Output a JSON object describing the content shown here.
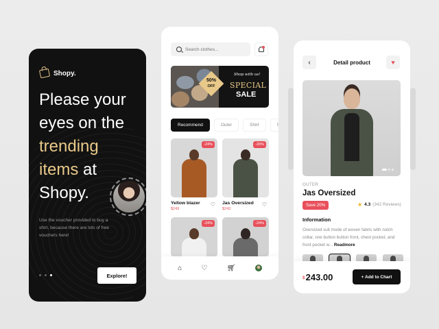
{
  "onboarding": {
    "brand": "Shopy.",
    "headline_1": "Please your eyes on the",
    "headline_gold": "trending items",
    "headline_2": " at Shopy.",
    "voucher_text": "Use the voucher provided to buy a shirt, because there are lots of free vouchers here!",
    "explore_label": "Explore!"
  },
  "home": {
    "search_placeholder": "Search clothes...",
    "banner": {
      "script": "Shop with us!",
      "badge_pct": "50%",
      "badge_off": "OFF",
      "special": "SPECIAL",
      "sale": "SALE"
    },
    "tabs": [
      {
        "label": "Recommend",
        "active": true
      },
      {
        "label": "Outer",
        "active": false
      },
      {
        "label": "Shirt",
        "active": false
      },
      {
        "label": "Sw",
        "active": false
      }
    ],
    "products": [
      {
        "name": "Yellow blazer",
        "price": "$243",
        "discount": "-24%",
        "coat": "#a85a25",
        "bg": "#d8d8d8"
      },
      {
        "name": "Jas Oversized",
        "price": "$243",
        "discount": "-20%",
        "coat": "#4a5246",
        "bg": "#e4e4e4"
      },
      {
        "name": "",
        "price": "",
        "discount": "-24%",
        "coat": "#f1f1f1",
        "bg": "#d5d5d5"
      },
      {
        "name": "",
        "price": "",
        "discount": "-24%",
        "coat": "#6a6a6a",
        "bg": "#d2d2d2"
      }
    ]
  },
  "detail": {
    "title": "Detail product",
    "category": "OUTER",
    "name": "Jas Oversized",
    "save": "Save 20%",
    "rating": "4.3",
    "reviews": "(342 Reviews)",
    "info_heading": "Information",
    "info_text": "Oversized suit mode of woven fabric with notch collar, one button button front, chest pocket, and front pocket w...",
    "readmore": "Readmore",
    "currency": "$",
    "price": "243.00",
    "add_label": "+ Add to Chart"
  },
  "colors": {
    "accent_gold": "#e9c989",
    "accent_red": "#e8505b",
    "dark": "#111111"
  }
}
